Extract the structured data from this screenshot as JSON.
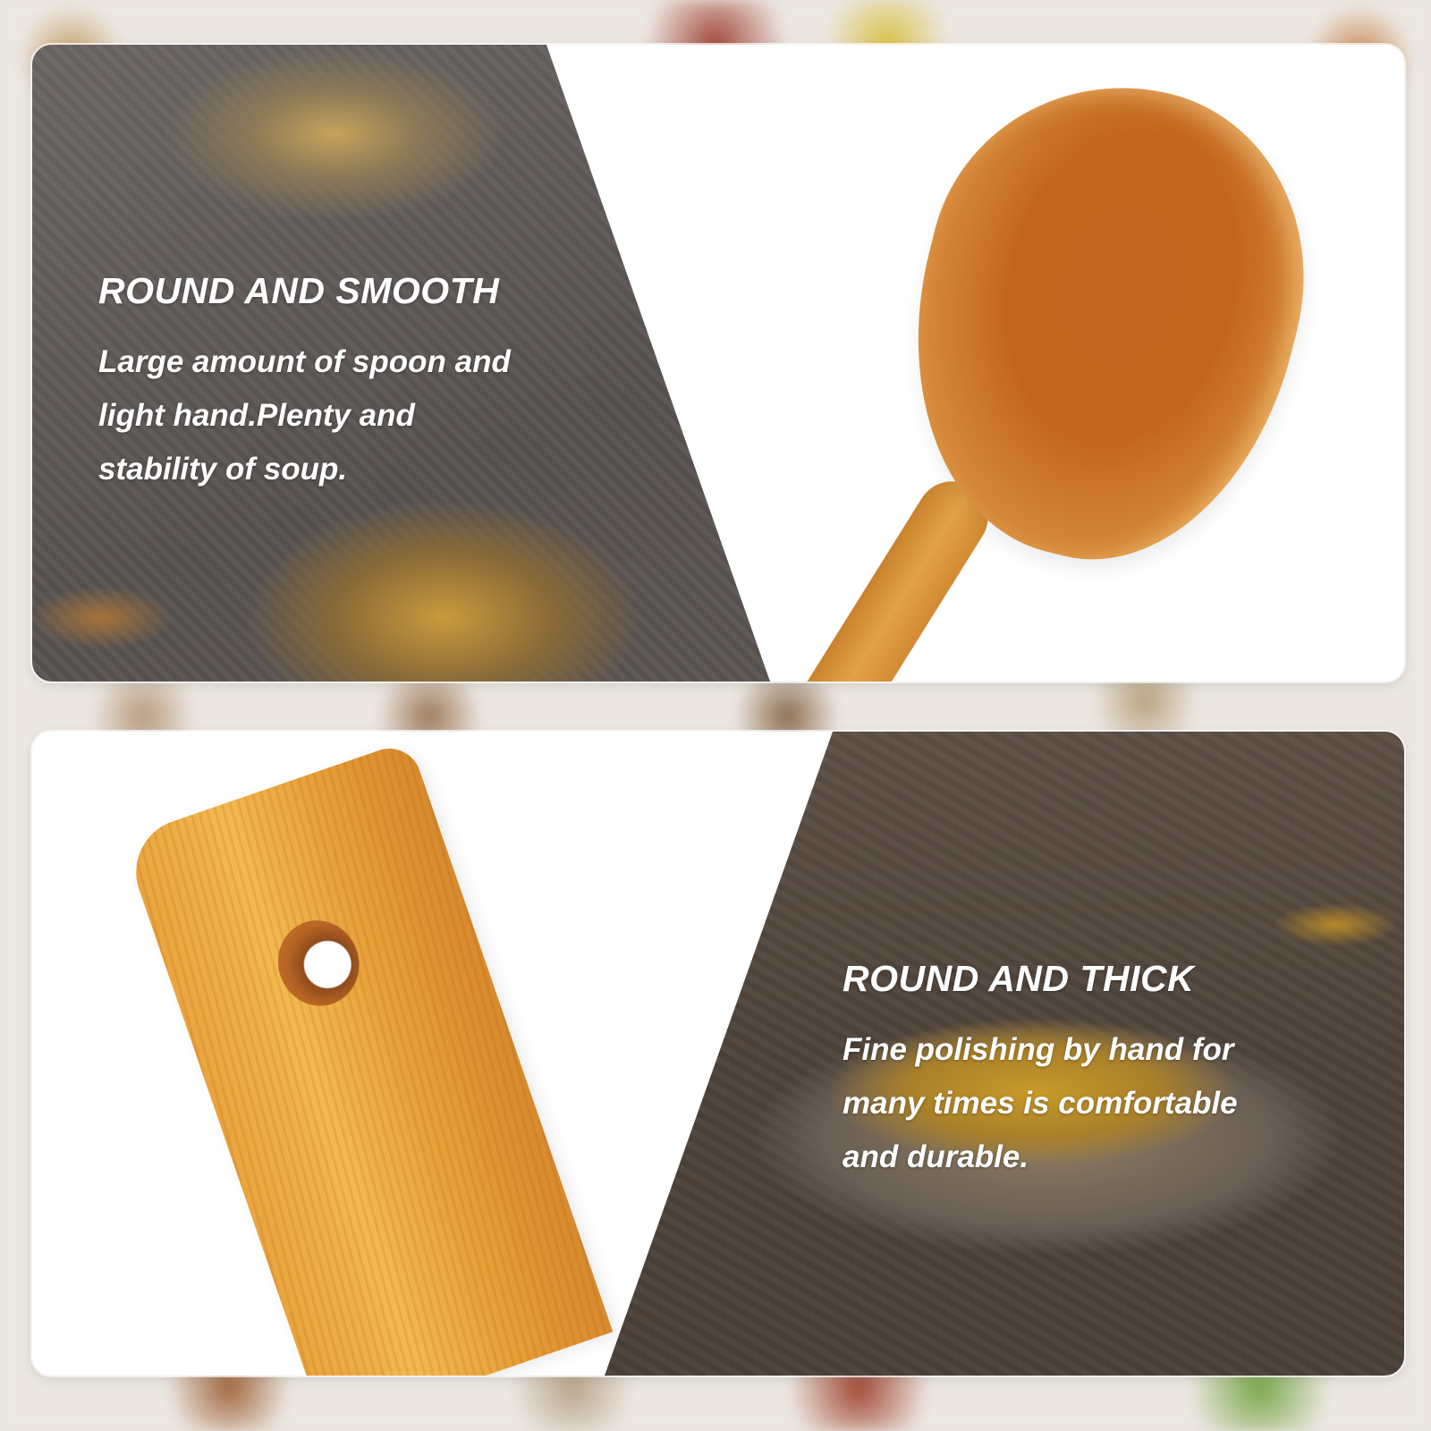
{
  "panels": [
    {
      "heading": "ROUND AND SMOOTH",
      "description": "Large amount of spoon and\nlight hand.Plenty and\nstability of soup."
    },
    {
      "heading": "ROUND AND THICK",
      "description": "Fine polishing by hand for\nmany times is comfortable\nand durable."
    }
  ]
}
